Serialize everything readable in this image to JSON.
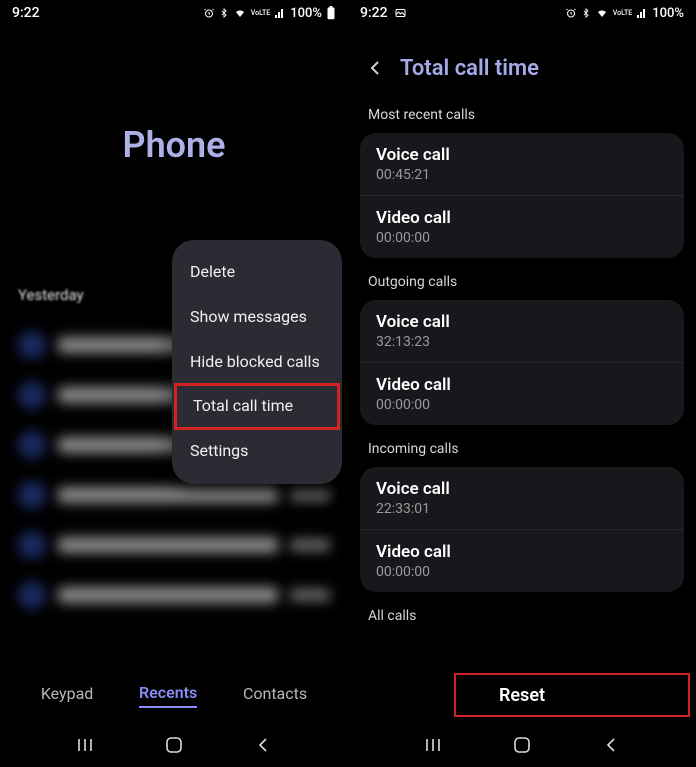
{
  "status": {
    "time": "9:22",
    "battery": "100%",
    "lte_label": "VoLTE"
  },
  "screen1": {
    "title": "Phone",
    "section": "Yesterday",
    "menu": {
      "delete": "Delete",
      "show_messages": "Show messages",
      "hide_blocked": "Hide blocked calls",
      "total_call_time": "Total call time",
      "settings": "Settings"
    },
    "tabs": {
      "keypad": "Keypad",
      "recents": "Recents",
      "contacts": "Contacts"
    }
  },
  "screen2": {
    "title": "Total call time",
    "groups": {
      "recent": {
        "label": "Most recent calls",
        "voice_label": "Voice call",
        "voice_time": "00:45:21",
        "video_label": "Video call",
        "video_time": "00:00:00"
      },
      "outgoing": {
        "label": "Outgoing calls",
        "voice_label": "Voice call",
        "voice_time": "32:13:23",
        "video_label": "Video call",
        "video_time": "00:00:00"
      },
      "incoming": {
        "label": "Incoming calls",
        "voice_label": "Voice call",
        "voice_time": "22:33:01",
        "video_label": "Video call",
        "video_time": "00:00:00"
      },
      "all": {
        "label": "All calls"
      }
    },
    "reset": "Reset"
  }
}
